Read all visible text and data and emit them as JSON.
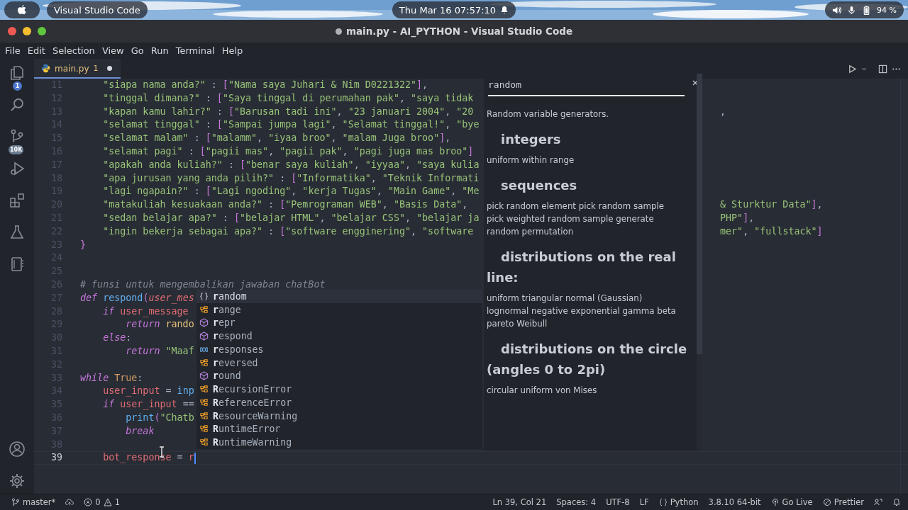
{
  "top_panel": {
    "app_menu": "Visual Studio Code",
    "clock": "Thu Mar 16  07:57:10",
    "battery": "94 %"
  },
  "window": {
    "title": "main.py - AI_PYTHON - Visual Studio Code",
    "modified": true
  },
  "menu": [
    "File",
    "Edit",
    "Selection",
    "View",
    "Go",
    "Run",
    "Terminal",
    "Help"
  ],
  "activity_bar": {
    "explorer_badge": "1",
    "source_control_badge": "10K"
  },
  "tabs": [
    {
      "label": "main.py",
      "problems": "1",
      "modified": true,
      "selected": true
    }
  ],
  "editor": {
    "lines": [
      {
        "number": "11",
        "current": false,
        "tokens": [
          {
            "kind": "string",
            "text": "    \"siapa nama anda?\""
          },
          {
            "kind": "plain",
            "text": " : "
          },
          {
            "kind": "bracket",
            "text": "["
          },
          {
            "kind": "string",
            "text": "\"Nama saya Juhari & Nim D0221322\""
          },
          {
            "kind": "bracket",
            "text": "]"
          },
          {
            "kind": "plain",
            "text": ","
          }
        ]
      },
      {
        "number": "12",
        "current": false,
        "tokens": [
          {
            "kind": "string",
            "text": "    \"tinggal dimana?\""
          },
          {
            "kind": "plain",
            "text": " : "
          },
          {
            "kind": "bracket",
            "text": "["
          },
          {
            "kind": "string",
            "text": "\"Saya tinggal di perumahan pak\""
          },
          {
            "kind": "plain",
            "text": ", "
          },
          {
            "kind": "string",
            "text": "\"saya tidak"
          }
        ]
      },
      {
        "number": "13",
        "current": false,
        "tokens": [
          {
            "kind": "string",
            "text": "    \"kapan kamu lahir?\""
          },
          {
            "kind": "plain",
            "text": " : "
          },
          {
            "kind": "bracket",
            "text": "["
          },
          {
            "kind": "string",
            "text": "\"Barusan tadi ini\""
          },
          {
            "kind": "plain",
            "text": ", "
          },
          {
            "kind": "string",
            "text": "\"23 januari 2004\""
          },
          {
            "kind": "plain",
            "text": ", "
          },
          {
            "kind": "string",
            "text": "\"20"
          }
        ],
        "right": [
          {
            "kind": "plain",
            "text": ","
          }
        ]
      },
      {
        "number": "14",
        "current": false,
        "tokens": [
          {
            "kind": "string",
            "text": "    \"selamat tinggal\""
          },
          {
            "kind": "plain",
            "text": " : "
          },
          {
            "kind": "bracket",
            "text": "["
          },
          {
            "kind": "string",
            "text": "\"Sampai jumpa lagi\""
          },
          {
            "kind": "plain",
            "text": ", "
          },
          {
            "kind": "string",
            "text": "\"Selamat tinggal!\""
          },
          {
            "kind": "plain",
            "text": ", "
          },
          {
            "kind": "string",
            "text": "\"bye"
          }
        ]
      },
      {
        "number": "15",
        "current": false,
        "tokens": [
          {
            "kind": "string",
            "text": "    \"selamat malam\""
          },
          {
            "kind": "plain",
            "text": " : "
          },
          {
            "kind": "bracket",
            "text": "["
          },
          {
            "kind": "string",
            "text": "\"malamm\""
          },
          {
            "kind": "plain",
            "text": ", "
          },
          {
            "kind": "string",
            "text": "\"iyaa broo\""
          },
          {
            "kind": "plain",
            "text": ", "
          },
          {
            "kind": "string",
            "text": "\"malam Juga broo\""
          },
          {
            "kind": "bracket",
            "text": "]"
          },
          {
            "kind": "plain",
            "text": ","
          }
        ]
      },
      {
        "number": "16",
        "current": false,
        "tokens": [
          {
            "kind": "string",
            "text": "    \"selamat pagi\""
          },
          {
            "kind": "plain",
            "text": " : "
          },
          {
            "kind": "bracket",
            "text": "["
          },
          {
            "kind": "string",
            "text": "\"pagii mas\""
          },
          {
            "kind": "plain",
            "text": ", "
          },
          {
            "kind": "string",
            "text": "\"pagii pak\""
          },
          {
            "kind": "plain",
            "text": ", "
          },
          {
            "kind": "string",
            "text": "\"pagi juga mas broo\""
          },
          {
            "kind": "bracket",
            "text": "]"
          }
        ]
      },
      {
        "number": "17",
        "current": false,
        "tokens": [
          {
            "kind": "string",
            "text": "    \"apakah anda kuliah?\""
          },
          {
            "kind": "plain",
            "text": " : "
          },
          {
            "kind": "bracket",
            "text": "["
          },
          {
            "kind": "string",
            "text": "\"benar saya kuliah\""
          },
          {
            "kind": "plain",
            "text": ", "
          },
          {
            "kind": "string",
            "text": "\"iyyaa\""
          },
          {
            "kind": "plain",
            "text": ", "
          },
          {
            "kind": "string",
            "text": "\"saya kulia"
          }
        ]
      },
      {
        "number": "18",
        "current": false,
        "tokens": [
          {
            "kind": "string",
            "text": "    \"apa jurusan yang anda pilih?\""
          },
          {
            "kind": "plain",
            "text": " : "
          },
          {
            "kind": "bracket",
            "text": "["
          },
          {
            "kind": "string",
            "text": "\"Informatika\""
          },
          {
            "kind": "plain",
            "text": ", "
          },
          {
            "kind": "string",
            "text": "\"Teknik Informati"
          }
        ]
      },
      {
        "number": "19",
        "current": false,
        "tokens": [
          {
            "kind": "string",
            "text": "    \"lagi ngapain?\""
          },
          {
            "kind": "plain",
            "text": " : "
          },
          {
            "kind": "bracket",
            "text": "["
          },
          {
            "kind": "string",
            "text": "\"Lagi ngoding\""
          },
          {
            "kind": "plain",
            "text": ", "
          },
          {
            "kind": "string",
            "text": "\"kerja Tugas\""
          },
          {
            "kind": "plain",
            "text": ", "
          },
          {
            "kind": "string",
            "text": "\"Main Game\""
          },
          {
            "kind": "plain",
            "text": ", "
          },
          {
            "kind": "string",
            "text": "\"Me"
          }
        ]
      },
      {
        "number": "20",
        "current": false,
        "tokens": [
          {
            "kind": "string",
            "text": "    \"matakuliah kesuakaan anda?\""
          },
          {
            "kind": "plain",
            "text": " : "
          },
          {
            "kind": "bracket",
            "text": "["
          },
          {
            "kind": "string",
            "text": "\"Pemrograman WEB\""
          },
          {
            "kind": "plain",
            "text": ", "
          },
          {
            "kind": "string",
            "text": "\"Basis Data\""
          },
          {
            "kind": "plain",
            "text": ", "
          }
        ],
        "right": [
          {
            "kind": "string",
            "text": "& Sturktur Data\""
          },
          {
            "kind": "bracket",
            "text": "]"
          },
          {
            "kind": "plain",
            "text": ","
          }
        ]
      },
      {
        "number": "21",
        "current": false,
        "tokens": [
          {
            "kind": "string",
            "text": "    \"sedan belajar apa?\""
          },
          {
            "kind": "plain",
            "text": " : "
          },
          {
            "kind": "bracket",
            "text": "["
          },
          {
            "kind": "string",
            "text": "\"belajar HTML\""
          },
          {
            "kind": "plain",
            "text": ", "
          },
          {
            "kind": "string",
            "text": "\"belajar CSS\""
          },
          {
            "kind": "plain",
            "text": ", "
          },
          {
            "kind": "string",
            "text": "\"belajar ja"
          }
        ],
        "right": [
          {
            "kind": "string",
            "text": "PHP\""
          },
          {
            "kind": "bracket",
            "text": "]"
          },
          {
            "kind": "plain",
            "text": ","
          }
        ]
      },
      {
        "number": "22",
        "current": false,
        "tokens": [
          {
            "kind": "string",
            "text": "    \"ingin bekerja sebagai apa?\""
          },
          {
            "kind": "plain",
            "text": " : "
          },
          {
            "kind": "bracket",
            "text": "["
          },
          {
            "kind": "string",
            "text": "\"software engginering\""
          },
          {
            "kind": "plain",
            "text": ", "
          },
          {
            "kind": "string",
            "text": "\"software"
          }
        ],
        "right": [
          {
            "kind": "string",
            "text": "mer\""
          },
          {
            "kind": "plain",
            "text": ", "
          },
          {
            "kind": "string",
            "text": "\"fullstack\""
          },
          {
            "kind": "bracket",
            "text": "]"
          }
        ]
      },
      {
        "number": "23",
        "current": false,
        "tokens": [
          {
            "kind": "bracket",
            "text": "}"
          }
        ]
      },
      {
        "number": "24",
        "current": false
      },
      {
        "number": "25",
        "current": false
      },
      {
        "number": "26",
        "current": false,
        "tokens": [
          {
            "kind": "comment",
            "text": "# funsi untuk mengembalikan jawaban chatBot"
          }
        ]
      },
      {
        "number": "27",
        "current": false,
        "tokens": [
          {
            "kind": "keyword",
            "text": "def "
          },
          {
            "kind": "function",
            "text": "respond"
          },
          {
            "kind": "bracket",
            "text": "("
          },
          {
            "kind": "parameter",
            "text": "user_mes"
          }
        ]
      },
      {
        "number": "28",
        "current": false,
        "tokens": [
          {
            "kind": "keyword",
            "text": "    if "
          },
          {
            "kind": "variable",
            "text": "user_message"
          }
        ]
      },
      {
        "number": "29",
        "current": false,
        "tokens": [
          {
            "kind": "keyword",
            "text": "        return "
          },
          {
            "kind": "module",
            "text": "rando"
          }
        ]
      },
      {
        "number": "30",
        "current": false,
        "tokens": [
          {
            "kind": "keyword",
            "text": "    else"
          },
          {
            "kind": "plain",
            "text": ":"
          }
        ]
      },
      {
        "number": "31",
        "current": false,
        "tokens": [
          {
            "kind": "keyword",
            "text": "        return "
          },
          {
            "kind": "string",
            "text": "\"Maaf"
          }
        ]
      },
      {
        "number": "32",
        "current": false
      },
      {
        "number": "33",
        "current": false,
        "tokens": [
          {
            "kind": "keyword",
            "text": "while "
          },
          {
            "kind": "constant",
            "text": "True"
          },
          {
            "kind": "plain",
            "text": ":"
          }
        ]
      },
      {
        "number": "34",
        "current": false,
        "tokens": [
          {
            "kind": "variable",
            "text": "    user_input"
          },
          {
            "kind": "plain",
            "text": " = "
          },
          {
            "kind": "function",
            "text": "inp"
          }
        ]
      },
      {
        "number": "35",
        "current": false,
        "tokens": [
          {
            "kind": "keyword",
            "text": "    if "
          },
          {
            "kind": "variable",
            "text": "user_input"
          },
          {
            "kind": "plain",
            "text": " =="
          }
        ]
      },
      {
        "number": "36",
        "current": false,
        "tokens": [
          {
            "kind": "function",
            "text": "        print"
          },
          {
            "kind": "bracket",
            "text": "("
          },
          {
            "kind": "string",
            "text": "\"Chatb"
          }
        ]
      },
      {
        "number": "37",
        "current": false,
        "tokens": [
          {
            "kind": "keyword",
            "text": "        break"
          }
        ]
      },
      {
        "number": "38",
        "current": false
      },
      {
        "number": "39",
        "current": true,
        "tokens": [
          {
            "kind": "variable",
            "text": "    bot_response"
          },
          {
            "kind": "plain",
            "text": " = "
          },
          {
            "kind": "variable",
            "text": "r"
          }
        ]
      }
    ]
  },
  "suggestions": [
    {
      "kind": "module",
      "label": "**r**andom",
      "selected": true
    },
    {
      "kind": "class",
      "label": "**r**ange",
      "selected": false
    },
    {
      "kind": "method",
      "label": "**r**epr",
      "selected": false
    },
    {
      "kind": "method",
      "label": "**r**espond",
      "selected": false
    },
    {
      "kind": "variable",
      "label": "**r**esponses",
      "selected": false
    },
    {
      "kind": "class",
      "label": "**r**eversed",
      "selected": false
    },
    {
      "kind": "method",
      "label": "**r**ound",
      "selected": false
    },
    {
      "kind": "class",
      "label": "**R**ecursionError",
      "selected": false
    },
    {
      "kind": "class",
      "label": "**R**eferenceError",
      "selected": false
    },
    {
      "kind": "class",
      "label": "**R**esourceWarning",
      "selected": false
    },
    {
      "kind": "class",
      "label": "**R**untimeError",
      "selected": false
    },
    {
      "kind": "class",
      "label": "**R**untimeWarning",
      "selected": false
    }
  ],
  "hover_doc": {
    "title": "random",
    "blocks": [
      {
        "kind": "paragraph",
        "text": "Random variable generators."
      },
      {
        "kind": "heading",
        "text": "integers"
      },
      {
        "kind": "paragraph",
        "text": "uniform within range"
      },
      {
        "kind": "heading",
        "text": "sequences"
      },
      {
        "kind": "paragraph",
        "text": "pick random element pick random sample pick weighted random sample generate random permutation"
      },
      {
        "kind": "heading",
        "text": "distributions on the real line:"
      },
      {
        "kind": "paragraph",
        "text": "uniform triangular normal (Gaussian) lognormal negative exponential gamma beta pareto Weibull"
      },
      {
        "kind": "heading",
        "text": "distributions on the circle (angles 0 to 2pi)"
      },
      {
        "kind": "paragraph",
        "text": "circular uniform von Mises"
      }
    ]
  },
  "status_bar": {
    "branch": "master*",
    "errors": "0",
    "warnings": "1",
    "position": "Ln 39, Col 21",
    "indent": "Spaces: 4",
    "encoding": "UTF-8",
    "eol": "LF",
    "language": "Python",
    "interpreter": "3.8.10 64-bit",
    "go_live": "Go Live",
    "formatter": "Prettier"
  }
}
